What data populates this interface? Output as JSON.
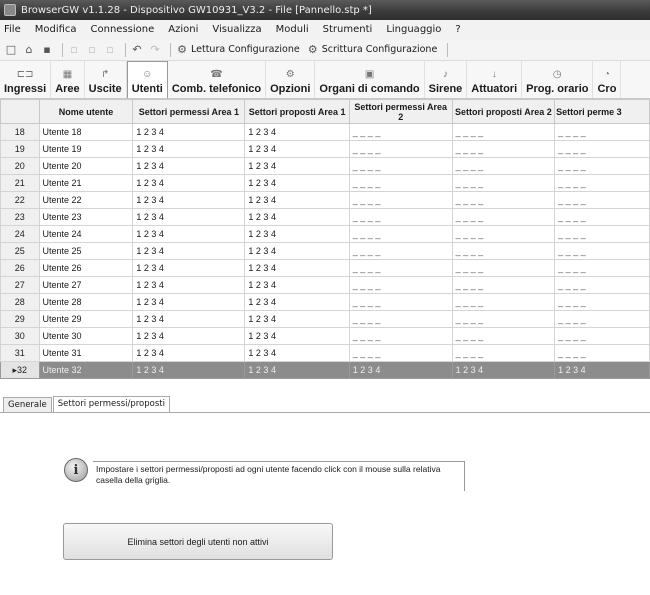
{
  "window": {
    "title": "BrowserGW v1.1.28 - Dispositivo   GW10931_V3.2  - File [Pannello.stp *]"
  },
  "menu": [
    "File",
    "Modifica",
    "Connessione",
    "Azioni",
    "Visualizza",
    "Moduli",
    "Strumenti",
    "Linguaggio",
    "?"
  ],
  "toolbar": {
    "read_label": "Lettura Configurazione",
    "write_label": "Scrittura Configurazione"
  },
  "ribbon": {
    "tabs": [
      {
        "label": "Ingressi",
        "icon": "inputs-icon",
        "active": false
      },
      {
        "label": "Aree",
        "icon": "areas-icon",
        "active": false
      },
      {
        "label": "Uscite",
        "icon": "outputs-icon",
        "active": false
      },
      {
        "label": "Utenti",
        "icon": "users-icon",
        "active": true
      },
      {
        "label": "Comb. telefonico",
        "icon": "phone-dialer-icon",
        "active": false
      },
      {
        "label": "Opzioni",
        "icon": "options-gear-icon",
        "active": false
      },
      {
        "label": "Organi di comando",
        "icon": "command-devices-icon",
        "active": false
      },
      {
        "label": "Sirene",
        "icon": "sirens-icon",
        "active": false
      },
      {
        "label": "Attuatori",
        "icon": "actuators-icon",
        "active": false
      },
      {
        "label": "Prog. orario",
        "icon": "clock-icon",
        "active": false
      },
      {
        "label": "Cro",
        "icon": "chrono-icon",
        "active": false
      }
    ]
  },
  "grid": {
    "columns": [
      "Nome utente",
      "Settori permessi Area 1",
      "Settori proposti Area 1",
      "Settori permessi Area 2",
      "Settori proposti Area 2",
      "Settori perme 3"
    ],
    "rows": [
      {
        "n": "18",
        "name": "Utente 18",
        "cells": [
          "1 2 3 4",
          "1 2 3 4",
          "_ _ _ _",
          "_ _ _ _",
          "_ _ _ _"
        ]
      },
      {
        "n": "19",
        "name": "Utente 19",
        "cells": [
          "1 2 3 4",
          "1 2 3 4",
          "_ _ _ _",
          "_ _ _ _",
          "_ _ _ _"
        ]
      },
      {
        "n": "20",
        "name": "Utente 20",
        "cells": [
          "1 2 3 4",
          "1 2 3 4",
          "_ _ _ _",
          "_ _ _ _",
          "_ _ _ _"
        ]
      },
      {
        "n": "21",
        "name": "Utente 21",
        "cells": [
          "1 2 3 4",
          "1 2 3 4",
          "_ _ _ _",
          "_ _ _ _",
          "_ _ _ _"
        ]
      },
      {
        "n": "22",
        "name": "Utente 22",
        "cells": [
          "1 2 3 4",
          "1 2 3 4",
          "_ _ _ _",
          "_ _ _ _",
          "_ _ _ _"
        ]
      },
      {
        "n": "23",
        "name": "Utente 23",
        "cells": [
          "1 2 3 4",
          "1 2 3 4",
          "_ _ _ _",
          "_ _ _ _",
          "_ _ _ _"
        ]
      },
      {
        "n": "24",
        "name": "Utente 24",
        "cells": [
          "1 2 3 4",
          "1 2 3 4",
          "_ _ _ _",
          "_ _ _ _",
          "_ _ _ _"
        ]
      },
      {
        "n": "25",
        "name": "Utente 25",
        "cells": [
          "1 2 3 4",
          "1 2 3 4",
          "_ _ _ _",
          "_ _ _ _",
          "_ _ _ _"
        ]
      },
      {
        "n": "26",
        "name": "Utente 26",
        "cells": [
          "1 2 3 4",
          "1 2 3 4",
          "_ _ _ _",
          "_ _ _ _",
          "_ _ _ _"
        ]
      },
      {
        "n": "27",
        "name": "Utente 27",
        "cells": [
          "1 2 3 4",
          "1 2 3 4",
          "_ _ _ _",
          "_ _ _ _",
          "_ _ _ _"
        ]
      },
      {
        "n": "28",
        "name": "Utente 28",
        "cells": [
          "1 2 3 4",
          "1 2 3 4",
          "_ _ _ _",
          "_ _ _ _",
          "_ _ _ _"
        ]
      },
      {
        "n": "29",
        "name": "Utente 29",
        "cells": [
          "1 2 3 4",
          "1 2 3 4",
          "_ _ _ _",
          "_ _ _ _",
          "_ _ _ _"
        ]
      },
      {
        "n": "30",
        "name": "Utente 30",
        "cells": [
          "1 2 3 4",
          "1 2 3 4",
          "_ _ _ _",
          "_ _ _ _",
          "_ _ _ _"
        ]
      },
      {
        "n": "31",
        "name": "Utente 31",
        "cells": [
          "1 2 3 4",
          "1 2 3 4",
          "_ _ _ _",
          "_ _ _ _",
          "_ _ _ _"
        ]
      },
      {
        "n": "32",
        "name": "Utente 32",
        "cells": [
          "1 2 3 4",
          "1 2 3 4",
          "1 2 3 4",
          "1 2 3 4",
          "1 2 3 4"
        ],
        "selected": true
      }
    ]
  },
  "bottom_tabs": [
    {
      "label": "Generale",
      "active": false
    },
    {
      "label": "Settori permessi/proposti",
      "active": true
    }
  ],
  "info": {
    "text": "Impostare i settori permessi/proposti ad ogni utente facendo click con il mouse sulla relativa casella della griglia."
  },
  "actions": {
    "delete_label": "Elimina settori degli utenti non attivi"
  }
}
